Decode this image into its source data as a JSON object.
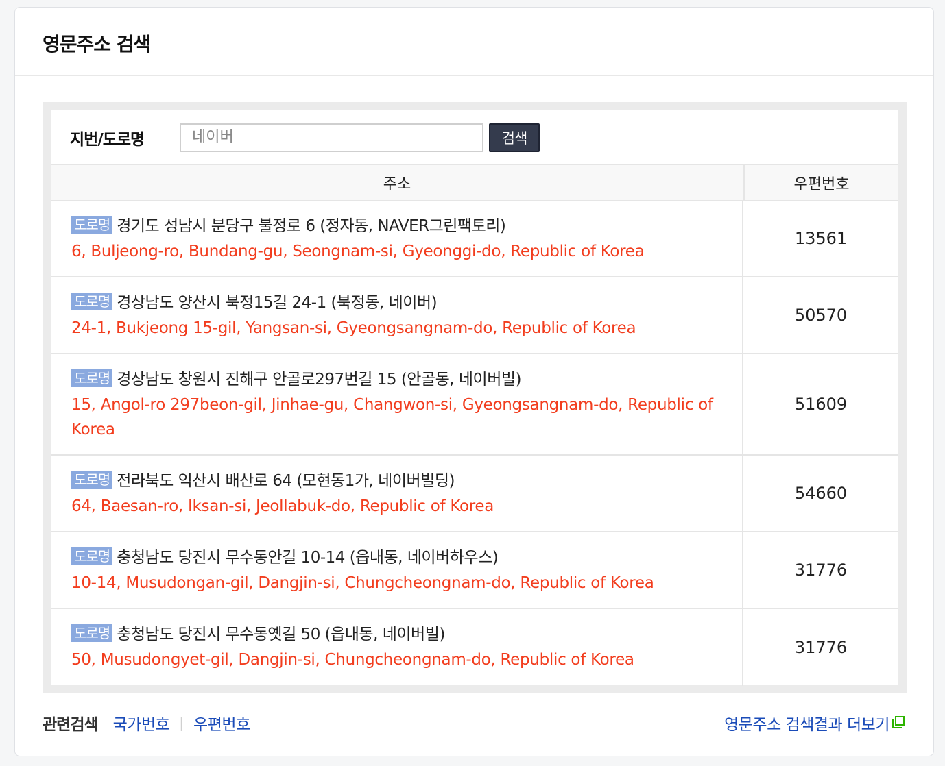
{
  "header": {
    "title": "영문주소 검색"
  },
  "search": {
    "label": "지번/도로명",
    "value": "",
    "placeholder": "네이버",
    "button_label": "검색"
  },
  "table": {
    "columns": {
      "address": "주소",
      "zip": "우편번호"
    },
    "rows": [
      {
        "tag": "도로명",
        "korean": "경기도 성남시 분당구 불정로 6 (정자동, NAVER그린팩토리)",
        "english": "6, Buljeong-ro, Bundang-gu, Seongnam-si, Gyeonggi-do, Republic of Korea",
        "zip": "13561"
      },
      {
        "tag": "도로명",
        "korean": "경상남도 양산시 북정15길 24-1 (북정동, 네이버)",
        "english": "24-1, Bukjeong 15-gil, Yangsan-si, Gyeongsangnam-do, Republic of Korea",
        "zip": "50570"
      },
      {
        "tag": "도로명",
        "korean": "경상남도 창원시 진해구 안골로297번길 15 (안골동, 네이버빌)",
        "english": "15, Angol-ro 297beon-gil, Jinhae-gu, Changwon-si, Gyeongsangnam-do, Republic of Korea",
        "zip": "51609"
      },
      {
        "tag": "도로명",
        "korean": "전라북도 익산시 배산로 64 (모현동1가, 네이버빌딩)",
        "english": "64, Baesan-ro, Iksan-si, Jeollabuk-do, Republic of Korea",
        "zip": "54660"
      },
      {
        "tag": "도로명",
        "korean": "충청남도 당진시 무수동안길 10-14 (읍내동, 네이버하우스)",
        "english": "10-14, Musudongan-gil, Dangjin-si, Chungcheongnam-do, Republic of Korea",
        "zip": "31776"
      },
      {
        "tag": "도로명",
        "korean": "충청남도 당진시 무수동옛길 50 (읍내동, 네이버빌)",
        "english": "50, Musudongyet-gil, Dangjin-si, Chungcheongnam-do, Republic of Korea",
        "zip": "31776"
      }
    ]
  },
  "footer": {
    "related_label": "관련검색",
    "links": [
      "국가번호",
      "우편번호"
    ],
    "more_label": "영문주소 검색결과 더보기",
    "more_icon": "external-window-icon"
  },
  "colors": {
    "english_address": "#f23d1e",
    "tag_background": "#8aa9df",
    "link": "#1a4bb8",
    "button_background": "#343b4d",
    "external_icon": "#2db400"
  }
}
